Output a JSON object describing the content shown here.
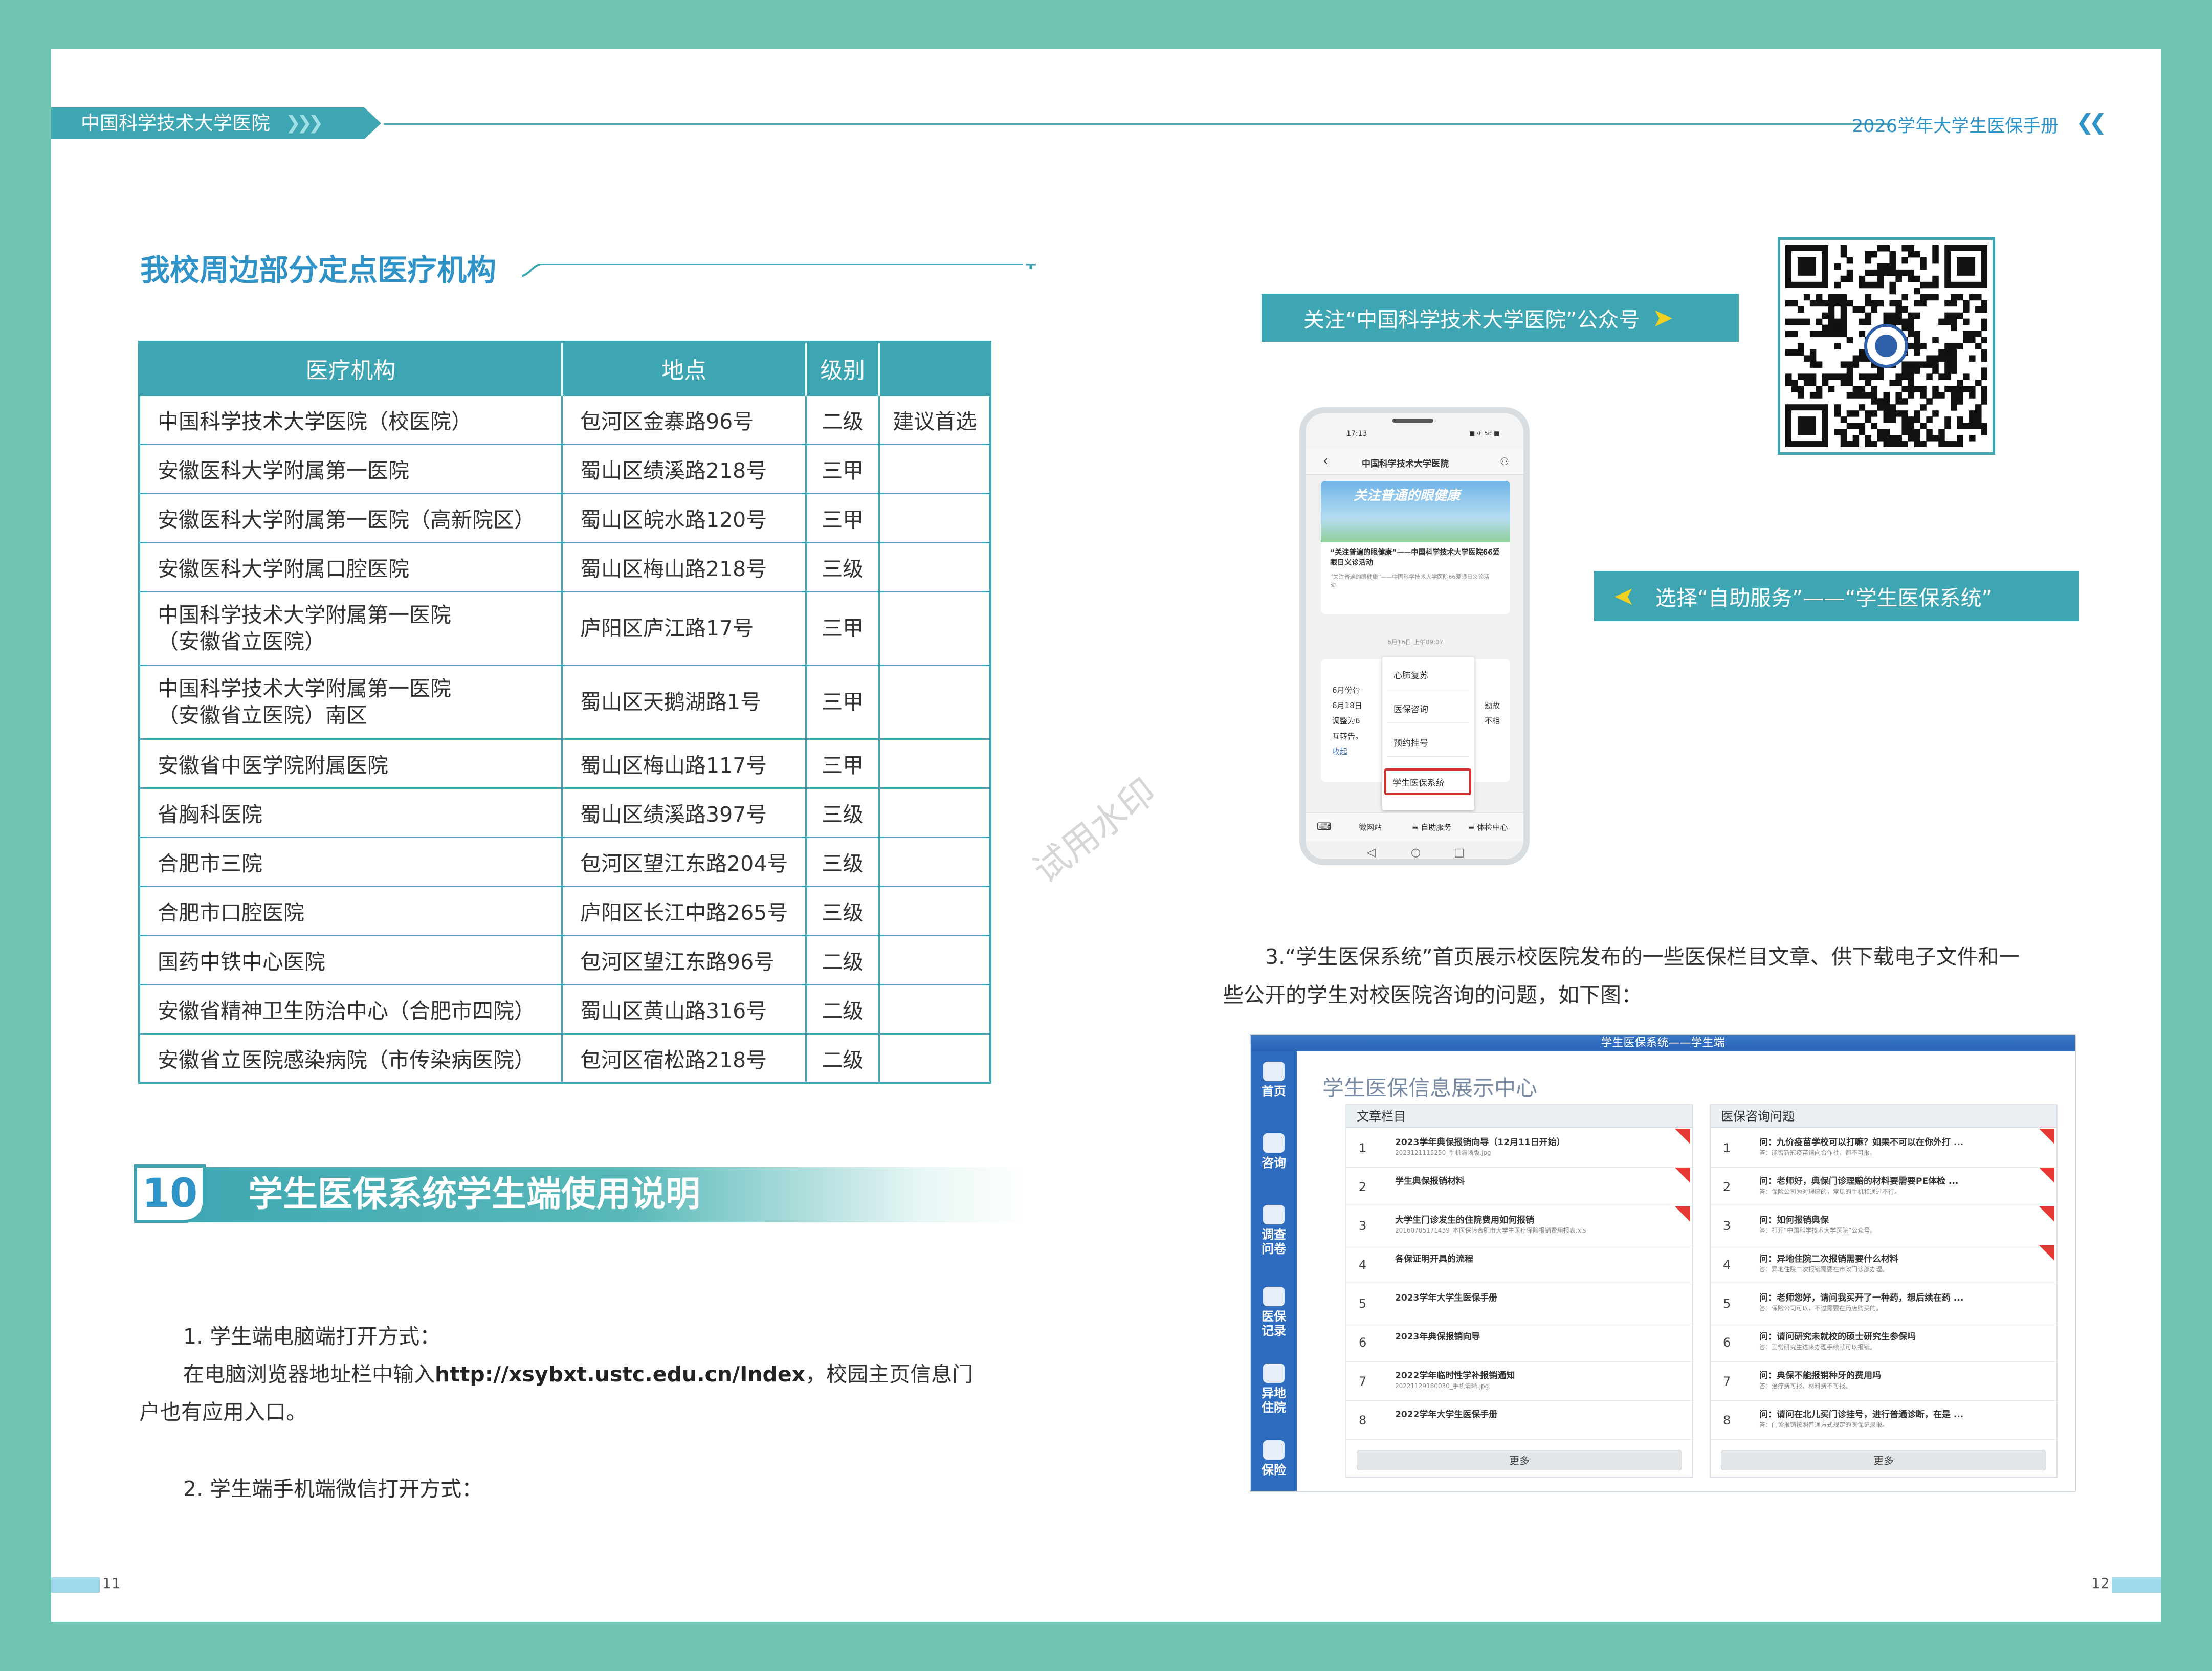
{
  "header": {
    "left_label": "中国科学技术大学医院",
    "left_arrows": "❯❯❯",
    "right_label": "2026学年大学生医保手册",
    "right_arrows": "❮❮"
  },
  "left": {
    "section_title": "我校周边部分定点医疗机构",
    "table": {
      "headers": [
        "医疗机构",
        "地点",
        "级别",
        ""
      ],
      "rows": [
        {
          "name": "中国科学技术大学医院（校医院）",
          "name2": "",
          "place": "包河区金寨路96号",
          "level": "二级",
          "note": "建议首选"
        },
        {
          "name": "安徽医科大学附属第一医院",
          "name2": "",
          "place": "蜀山区绩溪路218号",
          "level": "三甲",
          "note": ""
        },
        {
          "name": "安徽医科大学附属第一医院（高新院区）",
          "name2": "",
          "place": "蜀山区皖水路120号",
          "level": "三甲",
          "note": ""
        },
        {
          "name": "安徽医科大学附属口腔医院",
          "name2": "",
          "place": "蜀山区梅山路218号",
          "level": "三级",
          "note": ""
        },
        {
          "name": "中国科学技术大学附属第一医院",
          "name2": "（安徽省立医院）",
          "place": "庐阳区庐江路17号",
          "level": "三甲",
          "note": ""
        },
        {
          "name": "中国科学技术大学附属第一医院",
          "name2": "（安徽省立医院）南区",
          "place": "蜀山区天鹅湖路1号",
          "level": "三甲",
          "note": ""
        },
        {
          "name": "安徽省中医学院附属医院",
          "name2": "",
          "place": "蜀山区梅山路117号",
          "level": "三甲",
          "note": ""
        },
        {
          "name": "省胸科医院",
          "name2": "",
          "place": "蜀山区绩溪路397号",
          "level": "三级",
          "note": ""
        },
        {
          "name": "合肥市三院",
          "name2": "",
          "place": "包河区望江东路204号",
          "level": "三级",
          "note": ""
        },
        {
          "name": "合肥市口腔医院",
          "name2": "",
          "place": "庐阳区长江中路265号",
          "level": "三级",
          "note": ""
        },
        {
          "name": "国药中铁中心医院",
          "name2": "",
          "place": "包河区望江东路96号",
          "level": "二级",
          "note": ""
        },
        {
          "name": "安徽省精神卫生防治中心（合肥市四院）",
          "name2": "",
          "place": "蜀山区黄山路316号",
          "level": "二级",
          "note": ""
        },
        {
          "name": "安徽省立医院感染病院（市传染病医院）",
          "name2": "",
          "place": "包河区宿松路218号",
          "level": "二级",
          "note": ""
        }
      ]
    },
    "section10": {
      "number": "10",
      "title": "学生医保系统学生端使用说明"
    },
    "para1": "1. 学生端电脑端打开方式：",
    "para2_prefix": "在电脑浏览器地址栏中输入",
    "para2_url": "http://xsybxt.ustc.edu.cn/Index",
    "para2_suffix": "，校园主页信息门",
    "para3": "户也有应用入口。",
    "para4": "2. 学生端手机端微信打开方式："
  },
  "watermark": "试用水印",
  "right": {
    "follow_tag": "关注“中国科学技术大学医院”公众号",
    "select_tag": "选择“自助服务”——“学生医保系统”",
    "phone": {
      "time": "17:13",
      "status": "■ ✈ 5d ■",
      "account": "中国科学技术大学医院",
      "banner_title": "关注普通的眼健康",
      "article_title": "“关注普遍的眼健康”——中国科学技术大学医院66爱眼日义诊活动",
      "article_sub": "“关注普遍的眼健康”——中国科学技术大学医院66爱眼日义诊活动",
      "date": "6月16日 上午09:07",
      "msg_lines": [
        "6月份骨",
        "6月18日",
        "调整为6",
        "互转告。",
        "收起"
      ],
      "msg_right": [
        "题故",
        "不相"
      ],
      "menu": [
        "心肺复苏",
        "医保咨询",
        "预约挂号",
        "学生医保系统"
      ],
      "bottom_menu": [
        "微网站",
        "≡ 自助服务",
        "≡ 体检中心"
      ],
      "nav": [
        "◁",
        "○",
        "□"
      ]
    },
    "para1": "3.“学生医保系统”首页展示校医院发布的一些医保栏目文章、供下载电子文件和一",
    "para2": "些公开的学生对校医院咨询的问题，如下图：",
    "web": {
      "top_bar": "学生医保系统——学生端",
      "title": "学生医保信息展示中心",
      "side": [
        "首页",
        "咨询",
        "调查问卷",
        "医保记录",
        "异地住院",
        "保险"
      ],
      "left_panel": {
        "header": "文章栏目",
        "items": [
          {
            "num": "1",
            "title": "2023学年典保报销向导（12月11日开始）",
            "sub": "2023121115250_手机清晰版.jpg"
          },
          {
            "num": "2",
            "title": "学生典保报销材料",
            "sub": ""
          },
          {
            "num": "3",
            "title": "大学生门诊发生的住院费用如何报销",
            "sub": "20160705171439_本医保转合肥市大学生医疗保险报销费用报表.xls"
          },
          {
            "num": "4",
            "title": "各保证明开具的流程",
            "sub": ""
          },
          {
            "num": "5",
            "title": "2023学年大学生医保手册",
            "sub": ""
          },
          {
            "num": "6",
            "title": "2023年典保报销向导",
            "sub": ""
          },
          {
            "num": "7",
            "title": "2022学年临时性学补报销通知",
            "sub": "20221129180030_手机清晰.jpg"
          },
          {
            "num": "8",
            "title": "2022学年大学生医保手册",
            "sub": ""
          }
        ],
        "more": "更多"
      },
      "right_panel": {
        "header": "医保咨询问题",
        "items": [
          {
            "num": "1",
            "title": "问：九价疫苗学校可以打嘛？如果不可以在你外打 ...",
            "sub": "答：能否新冠疫苗请向合作社，都不可报。"
          },
          {
            "num": "2",
            "title": "问：老师好，典保门诊理赔的材料要需要PE体检 ...",
            "sub": "答：保险公司为对理赔的，常见的手机和通过不行。"
          },
          {
            "num": "3",
            "title": "问：如何报销典保",
            "sub": "答：打开“中国科学技术大学医院”公众号。"
          },
          {
            "num": "4",
            "title": "问：异地住院二次报销需要什么材料",
            "sub": "答：异地住院二次报销需要在市政门诊部办理。"
          },
          {
            "num": "5",
            "title": "问：老师您好，请问我买开了一种药，想后续在药 ...",
            "sub": "答：保险公司可以，不过需要在药店购买的。"
          },
          {
            "num": "6",
            "title": "问：请问研究未就校的硕士研究生参保吗",
            "sub": "答：正常研究生进来办理手续就可以报销。"
          },
          {
            "num": "7",
            "title": "问：典保不能报销种牙的费用吗",
            "sub": "答：治疗费可报，材料费不可报。"
          },
          {
            "num": "8",
            "title": "问：请问在北儿买门诊挂号，进行普通诊断，在是 ...",
            "sub": "答：门诊报销按照普通方式规定的医保记录报。"
          }
        ],
        "more": "更多"
      }
    }
  },
  "page_numbers": {
    "left": "11",
    "right": "12"
  },
  "colors": {
    "teal": "#3da6b2",
    "border_green": "#6fc5b1",
    "title_blue": "#2f93c7",
    "arrow_yellow": "#f0d020"
  }
}
